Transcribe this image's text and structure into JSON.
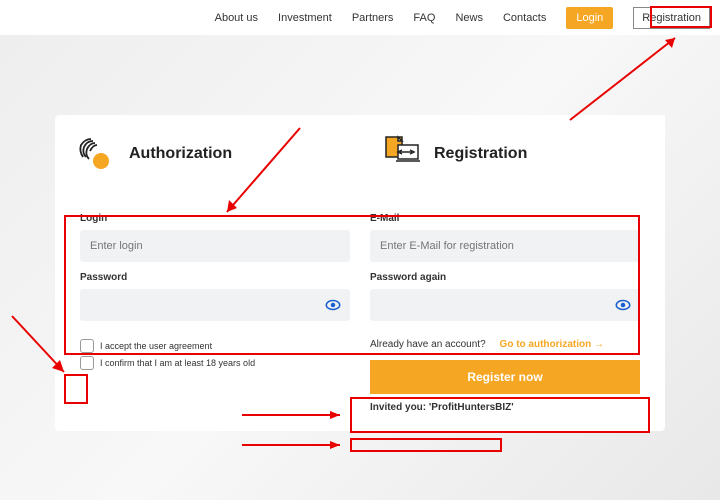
{
  "nav": {
    "items": [
      "About us",
      "Investment",
      "Partners",
      "FAQ",
      "News",
      "Contacts"
    ],
    "login": "Login",
    "registration": "Registration"
  },
  "tabs": {
    "auth": "Authorization",
    "reg": "Registration"
  },
  "form": {
    "login_label": "Login",
    "login_ph": "Enter login",
    "email_label": "E-Mail",
    "email_ph": "Enter E-Mail for registration",
    "password_label": "Password",
    "password2_label": "Password again"
  },
  "checks": {
    "agreement": "I accept the user agreement",
    "age": "I confirm that I am at least 18 years old"
  },
  "already": {
    "text": "Already have an account?",
    "link": "Go to authorization"
  },
  "register_btn": "Register now",
  "invited": "Invited you: 'ProfitHuntersBIZ'"
}
